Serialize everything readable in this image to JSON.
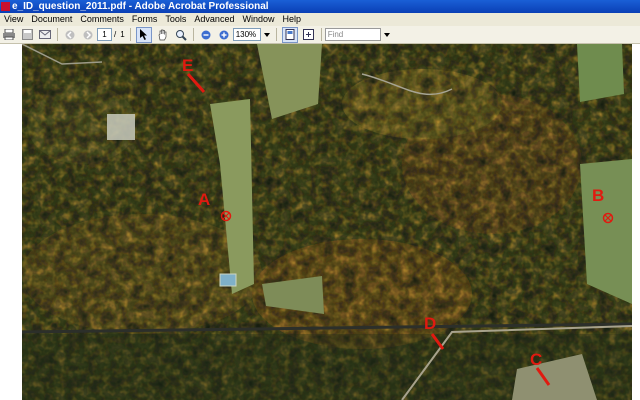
{
  "window": {
    "title": "e_ID_question_2011.pdf - Adobe Acrobat Professional"
  },
  "menu": [
    "View",
    "Document",
    "Comments",
    "Forms",
    "Tools",
    "Advanced",
    "Window",
    "Help"
  ],
  "toolbar": {
    "page_current": "1",
    "page_total": "1",
    "zoom": "130%",
    "find_placeholder": "Find"
  },
  "map": {
    "labels": [
      "A",
      "B",
      "C",
      "D",
      "E"
    ]
  },
  "colors": {
    "marker": "#e01a10",
    "titlebar": "#0a3fb5"
  }
}
